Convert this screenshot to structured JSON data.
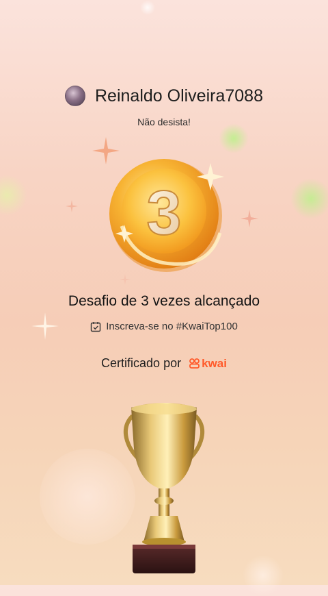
{
  "user": {
    "name": "Reinaldo Oliveira7088",
    "tagline": "Não desista!"
  },
  "medal": {
    "number": "3",
    "icon": "medal-icon"
  },
  "achievement": {
    "title": "Desafio de 3 vezes alcançado",
    "subscribe_text": "Inscreva-se no #KwaiTop100",
    "subscribe_icon": "calendar-check-icon"
  },
  "certification": {
    "label": "Certificado por",
    "brand": "kwai",
    "brand_color": "#ff5a2a"
  },
  "decoration": {
    "trophy_icon": "trophy-icon",
    "accent": "#f2a04a"
  }
}
